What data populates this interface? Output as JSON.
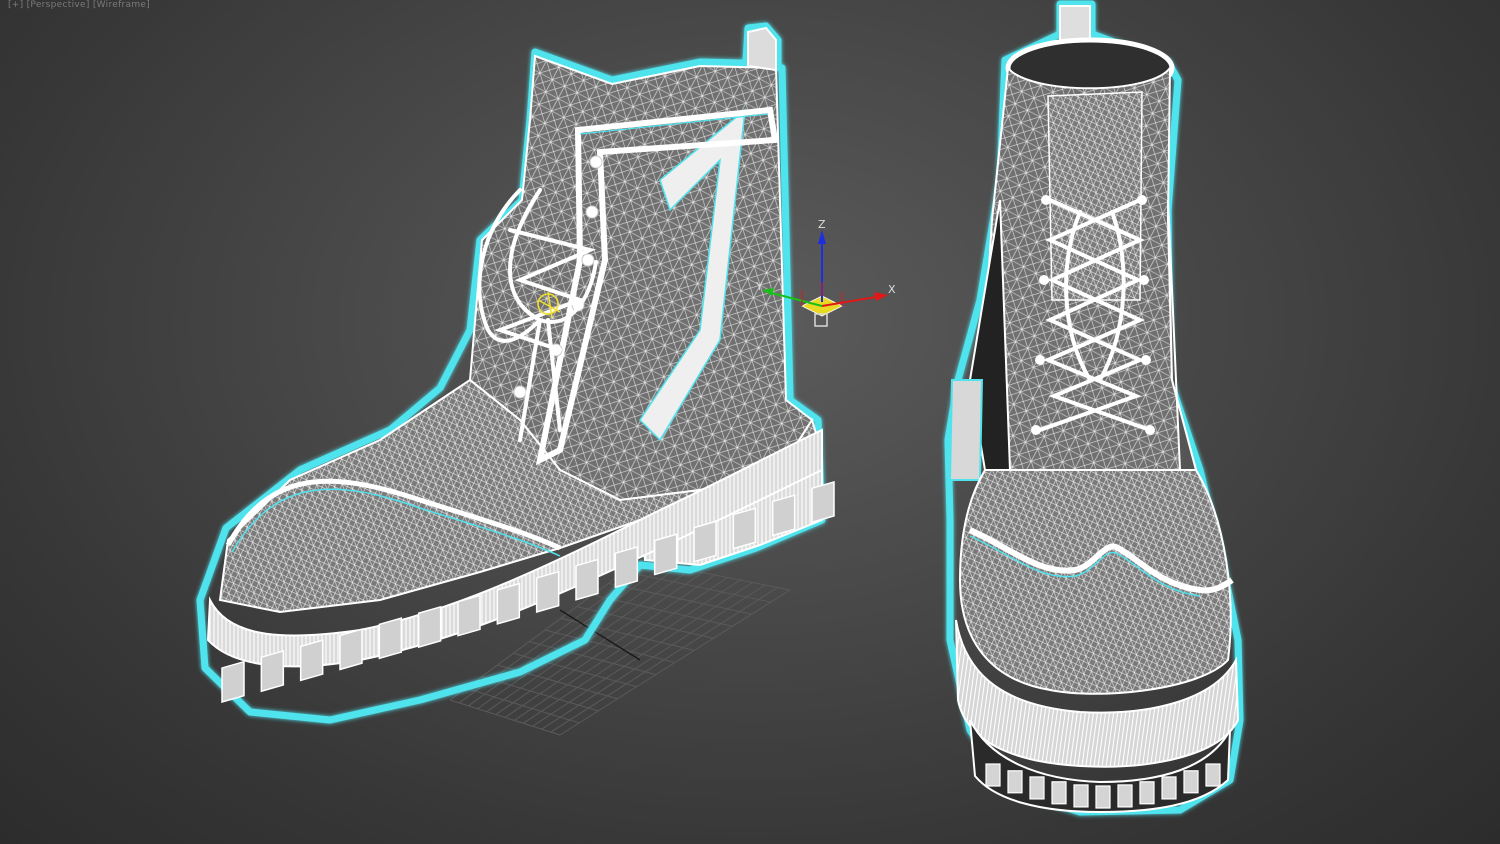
{
  "viewport": {
    "label": "[+] [Perspective] [Wireframe]"
  },
  "gizmo": {
    "x_label": "X",
    "y_label": "Y",
    "z_label": "Z",
    "x_color": "#e01818",
    "y_color": "#18c018",
    "z_color": "#1c2ee0",
    "plane_color": "#f0e020"
  },
  "scene": {
    "objects": [
      "boot-side-view",
      "boot-front-view"
    ],
    "wire_color": "#ffffff",
    "selection_outline_color": "#4fe3ee",
    "shade_color": "#6b6b6b",
    "grid_color": "#5a5a5a"
  }
}
